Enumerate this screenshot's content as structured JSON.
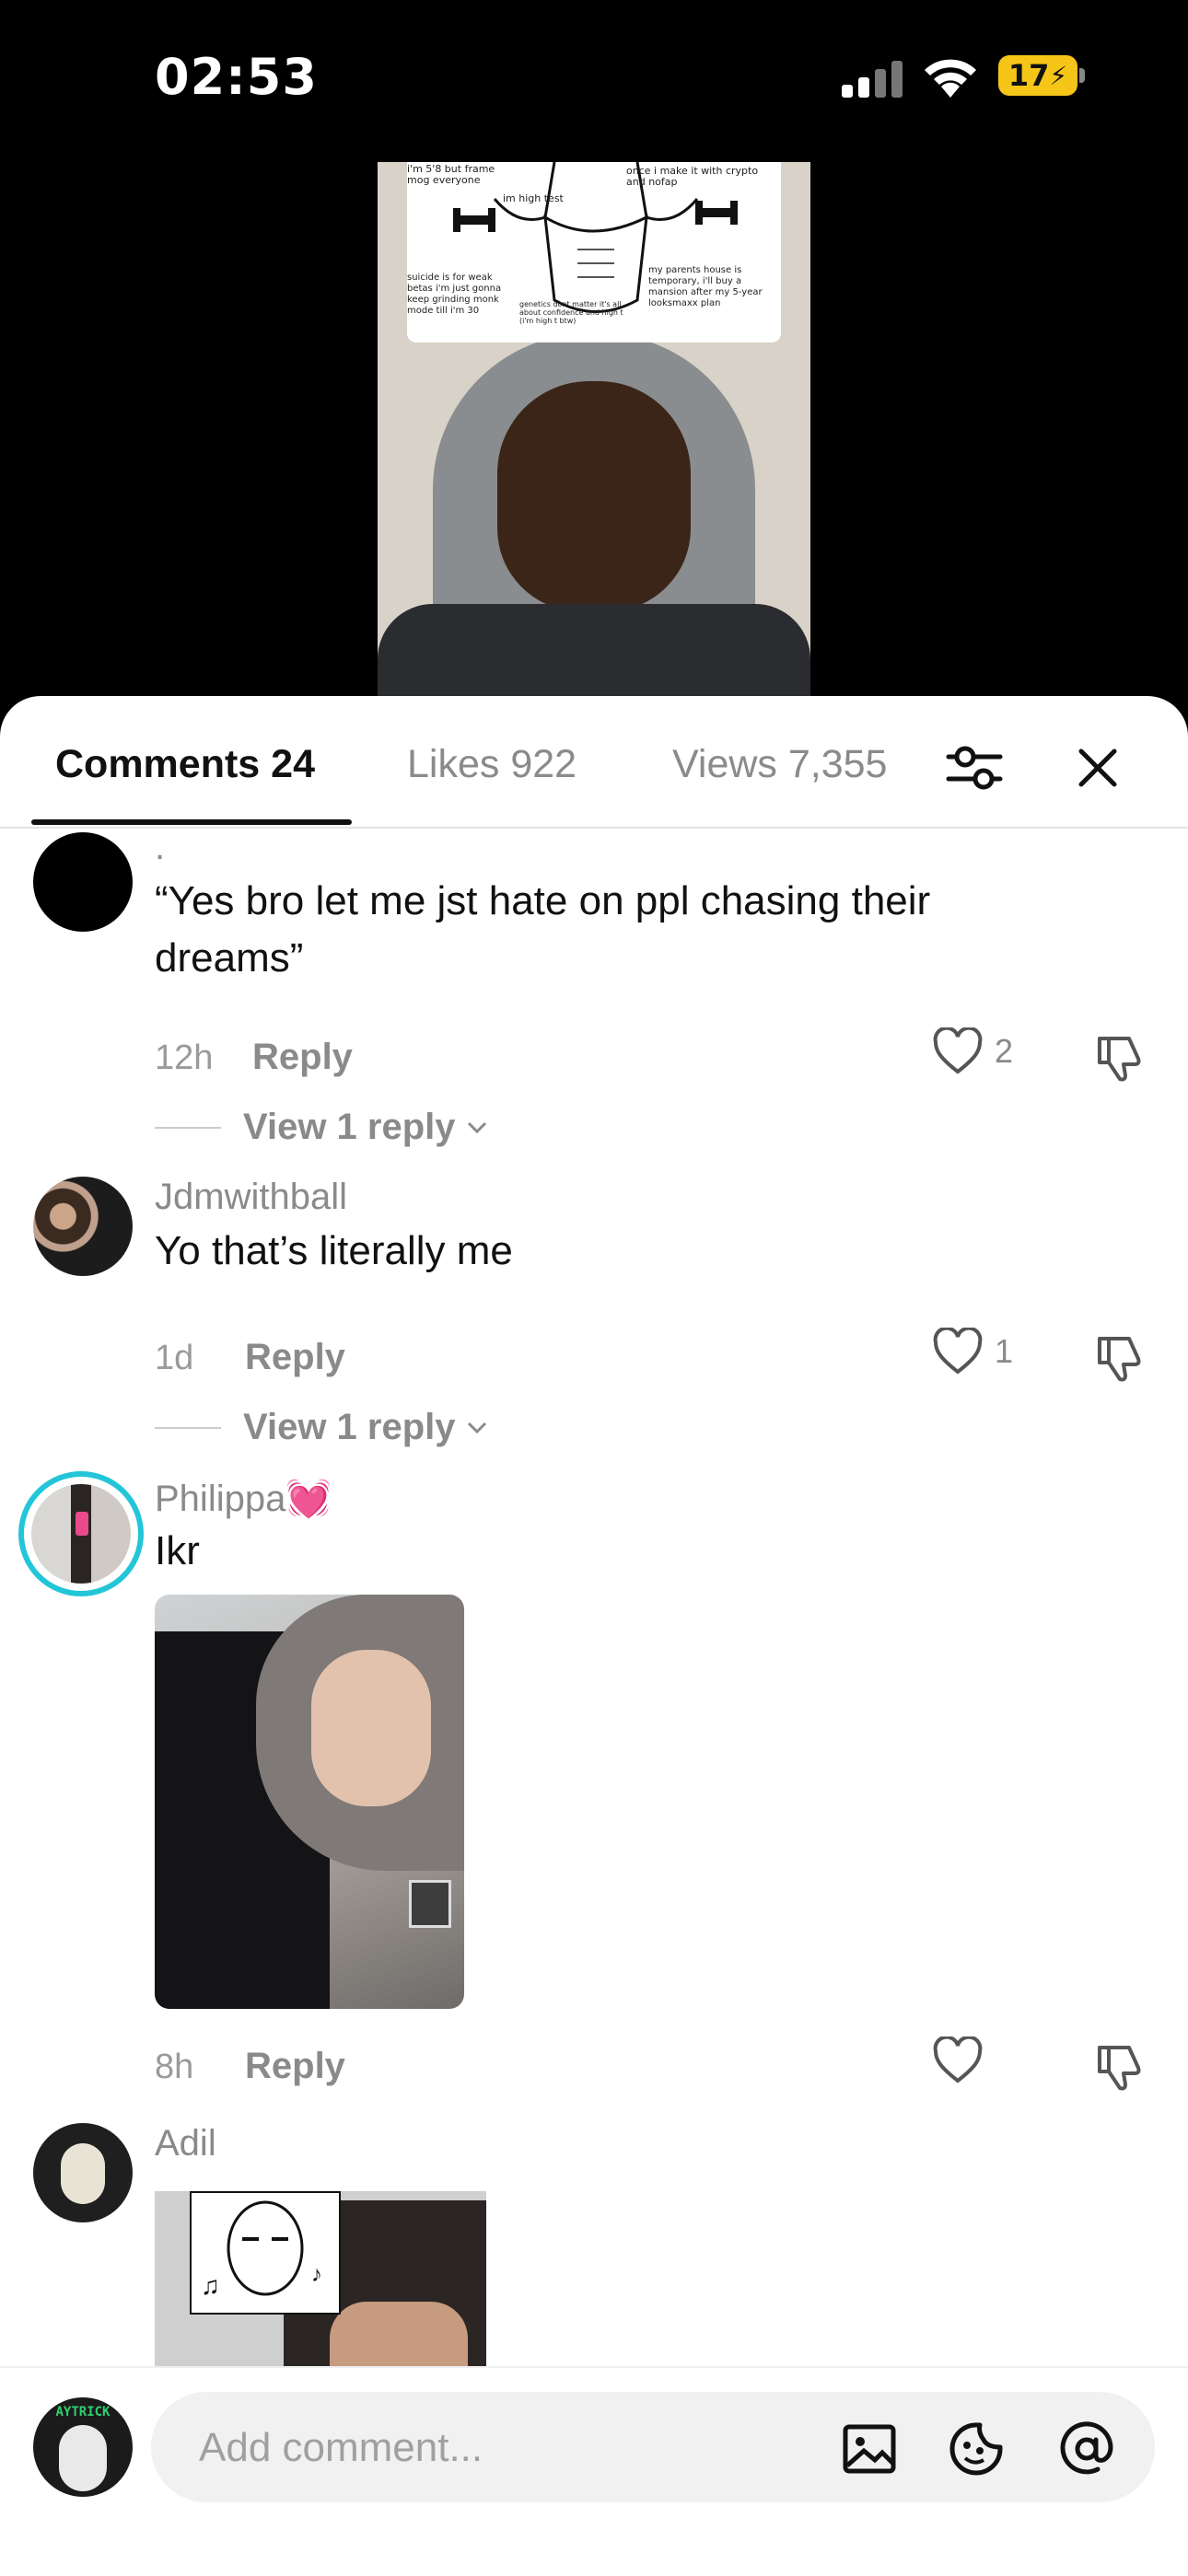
{
  "status": {
    "time": "02:53",
    "battery": "17"
  },
  "video": {
    "meme_text": {
      "a": "i'm 5'8 but frame mog everyone",
      "b": "once i make it with crypto and nofap",
      "c": "im high test",
      "d": "suicide is for weak betas i'm just gonna keep grinding monk mode till i'm 30",
      "e": "genetics dont matter it's all about confidence and high t (i'm high t btw)",
      "f": "my parents house is temporary, i'll buy a mansion after my 5-year looksmaxx plan"
    }
  },
  "tabs": [
    {
      "label": "Comments 24"
    },
    {
      "label": "Likes 922"
    },
    {
      "label": "Views 7,355"
    }
  ],
  "comments": [
    {
      "username": ".",
      "text": "“Yes bro let me jst hate on ppl chasing their dreams”",
      "time": "12h",
      "reply_label": "Reply",
      "likes": "2",
      "view_replies": "View 1 reply"
    },
    {
      "username": "Jdmwithball",
      "text": "Yo that’s literally me",
      "time": "1d",
      "reply_label": "Reply",
      "likes": "1",
      "view_replies": "View 1 reply"
    },
    {
      "username": "Philippa",
      "username_emoji": "💓",
      "text": "Ikr",
      "time": "8h",
      "reply_label": "Reply",
      "likes": ""
    },
    {
      "username": "Adil"
    }
  ],
  "composer": {
    "placeholder": "Add comment...",
    "avatar_text": "AYTRICK"
  },
  "colors": {
    "accent_ring": "#22c6d8",
    "battery": "#f5c518"
  }
}
